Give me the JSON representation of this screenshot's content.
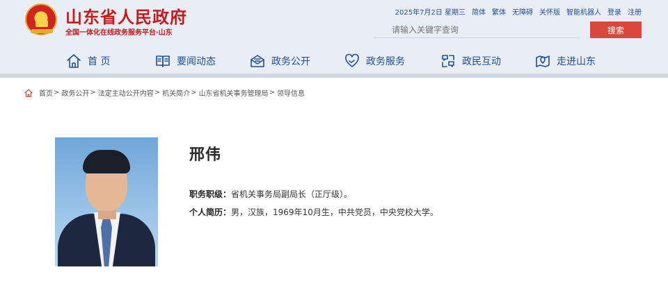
{
  "site": {
    "title": "山东省人民政府",
    "subtitle": "全国一体化在线政务服务平台·山东"
  },
  "topbar": {
    "date": "2025年7月2日 星期三",
    "links": [
      "简体",
      "繁体",
      "无障碍",
      "关怀版",
      "智能机器人",
      "登录",
      "注册"
    ]
  },
  "search": {
    "placeholder": "请输入关键字查询",
    "button": "搜索"
  },
  "nav": [
    {
      "label": "首 页",
      "icon": "home-icon"
    },
    {
      "label": "要闻动态",
      "icon": "book-icon"
    },
    {
      "label": "政务公开",
      "icon": "mail-icon"
    },
    {
      "label": "政务服务",
      "icon": "heart-icon"
    },
    {
      "label": "政民互动",
      "icon": "chat-icon"
    },
    {
      "label": "走进山东",
      "icon": "map-pin-icon"
    }
  ],
  "breadcrumb": [
    "首页",
    "政务公开",
    "法定主动公开内容",
    "机关简介",
    "山东省机关事务管理局",
    "领导信息"
  ],
  "profile": {
    "name": "邢伟",
    "position_label": "职务职级：",
    "position_value": "省机关事务局副局长（正厅级）。",
    "bio_label": "个人简历：",
    "bio_value": "男，汉族，1969年10月生，中共党员，中央党校大学。"
  },
  "colors": {
    "brand_red": "#c8191d",
    "nav_blue": "#1f4e9a",
    "search_button": "#d9483a"
  }
}
